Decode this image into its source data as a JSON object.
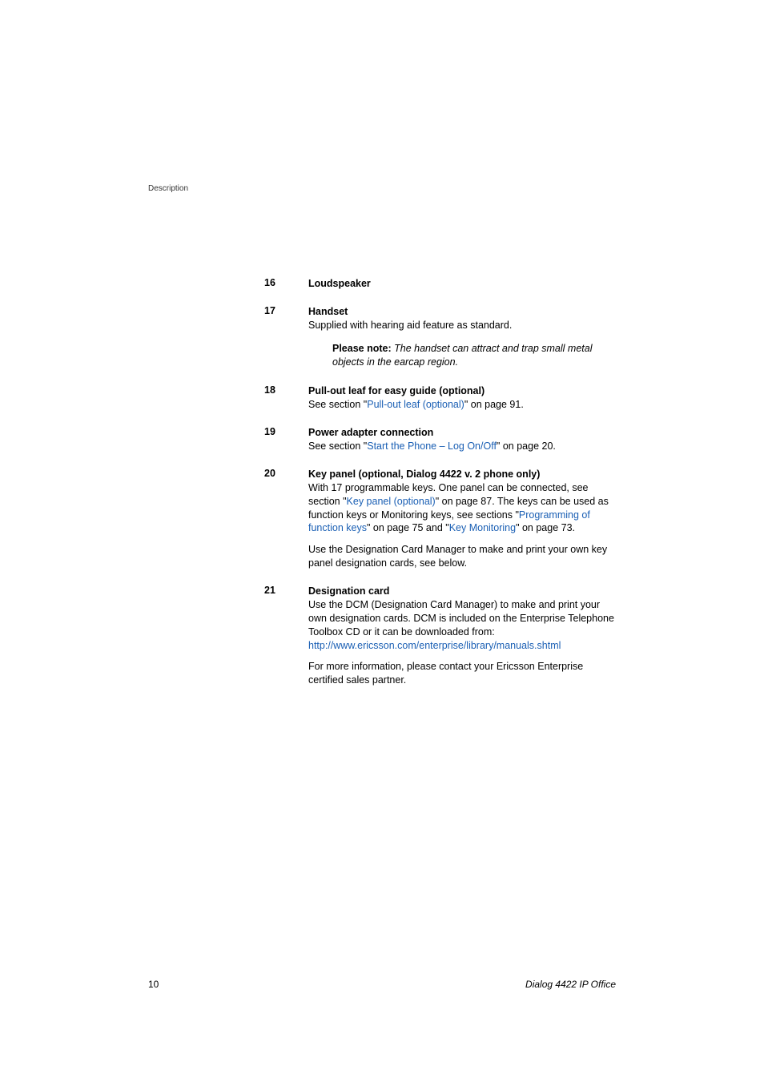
{
  "header": {
    "section": "Description"
  },
  "items": {
    "i16": {
      "number": "16",
      "title": "Loudspeaker"
    },
    "i17": {
      "number": "17",
      "title": "Handset",
      "desc": "Supplied with hearing aid feature as standard.",
      "note_label": "Please note:",
      "note_text_1": "The handset can attract and trap small metal objects in the earcap region."
    },
    "i18": {
      "number": "18",
      "title": "Pull-out leaf for easy guide (optional)",
      "desc_pre": "See section \"",
      "link": "Pull-out leaf (optional)",
      "desc_post": "\" on page 91."
    },
    "i19": {
      "number": "19",
      "title": "Power adapter connection",
      "desc_pre": "See section \"",
      "link": "Start the Phone – Log On/Off",
      "desc_post": "\" on page 20."
    },
    "i20": {
      "number": "20",
      "title": "Key panel (optional, Dialog 4422 v. 2 phone only)",
      "d1": "With 17 programmable keys. One panel can be connected, see section \"",
      "link1": "Key panel (optional)",
      "d2": "\" on page 87. The keys can be used as function keys or Monitoring keys, see sections \"",
      "link2": "Programming of function keys",
      "d3": "\" on page 75 and \"",
      "link3": "Key Monitoring",
      "d4": "\" on page 73.",
      "p2": "Use the Designation Card Manager to make and print your own key panel designation cards, see below."
    },
    "i21": {
      "number": "21",
      "title": "Designation card",
      "d1": "Use the DCM (Designation Card Manager) to make and print your own designation cards. DCM is included on the Enterprise Telephone Toolbox CD or it can be downloaded from:",
      "link": "http://www.ericsson.com/enterprise/library/manuals.shtml",
      "p2": "For more information, please contact your Ericsson Enterprise certified sales partner."
    }
  },
  "footer": {
    "page": "10",
    "title": "Dialog 4422 IP Office"
  }
}
